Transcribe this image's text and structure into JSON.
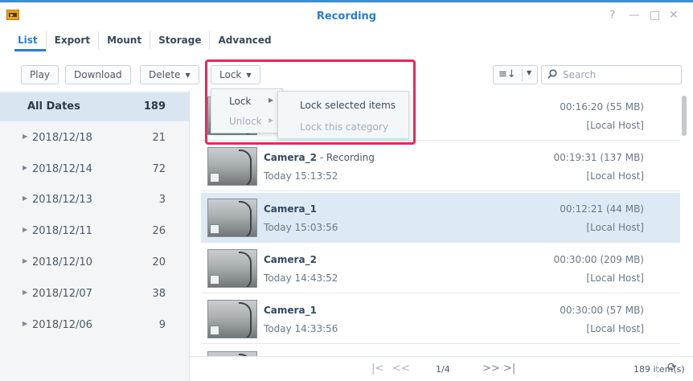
{
  "window": {
    "title": "Recording",
    "controls": {
      "help": "?",
      "minimize": "—",
      "maximize": "□",
      "close": "✕"
    }
  },
  "tabs": [
    {
      "label": "List",
      "active": true
    },
    {
      "label": "Export"
    },
    {
      "label": "Mount"
    },
    {
      "label": "Storage"
    },
    {
      "label": "Advanced"
    }
  ],
  "toolbar": {
    "play": "Play",
    "download": "Download",
    "delete": "Delete",
    "lock": "Lock",
    "search_placeholder": "Search"
  },
  "date_filter": [
    {
      "label": "All Dates",
      "count": "189",
      "selected": true
    },
    {
      "label": "2018/12/18",
      "count": "21"
    },
    {
      "label": "2018/12/14",
      "count": "72"
    },
    {
      "label": "2018/12/13",
      "count": "3"
    },
    {
      "label": "2018/12/11",
      "count": "26"
    },
    {
      "label": "2018/12/10",
      "count": "20"
    },
    {
      "label": "2018/12/07",
      "count": "38"
    },
    {
      "label": "2018/12/06",
      "count": "9"
    }
  ],
  "recordings": [
    {
      "camera": "",
      "status": "",
      "time": "",
      "duration": "00:16:20 (55 MB)",
      "host": "[Local Host]"
    },
    {
      "camera": "Camera_2",
      "status": " - Recording",
      "time": "Today 15:13:52",
      "duration": "00:19:31 (137 MB)",
      "host": "[Local Host]"
    },
    {
      "camera": "Camera_1",
      "status": "",
      "time": "Today 15:03:56",
      "duration": "00:12:21 (44 MB)",
      "host": "[Local Host]",
      "selected": true
    },
    {
      "camera": "Camera_2",
      "status": "",
      "time": "Today 14:43:52",
      "duration": "00:30:00 (209 MB)",
      "host": "[Local Host]"
    },
    {
      "camera": "Camera_1",
      "status": "",
      "time": "Today 14:33:56",
      "duration": "00:30:00 (57 MB)",
      "host": "[Local Host]"
    }
  ],
  "lock_menu": {
    "lock": "Lock",
    "unlock": "Unlock",
    "submenu": {
      "lock_selected": "Lock selected items",
      "lock_category": "Lock this category"
    }
  },
  "pagination": {
    "first": "|<",
    "prev": "<<",
    "page": "1/4",
    "next": ">>",
    "last": ">|",
    "total": "189 item(s)"
  },
  "colors": {
    "accent": "#2a7ccf",
    "selected_row": "#dde9f4",
    "highlight_border": "#e8285b"
  }
}
